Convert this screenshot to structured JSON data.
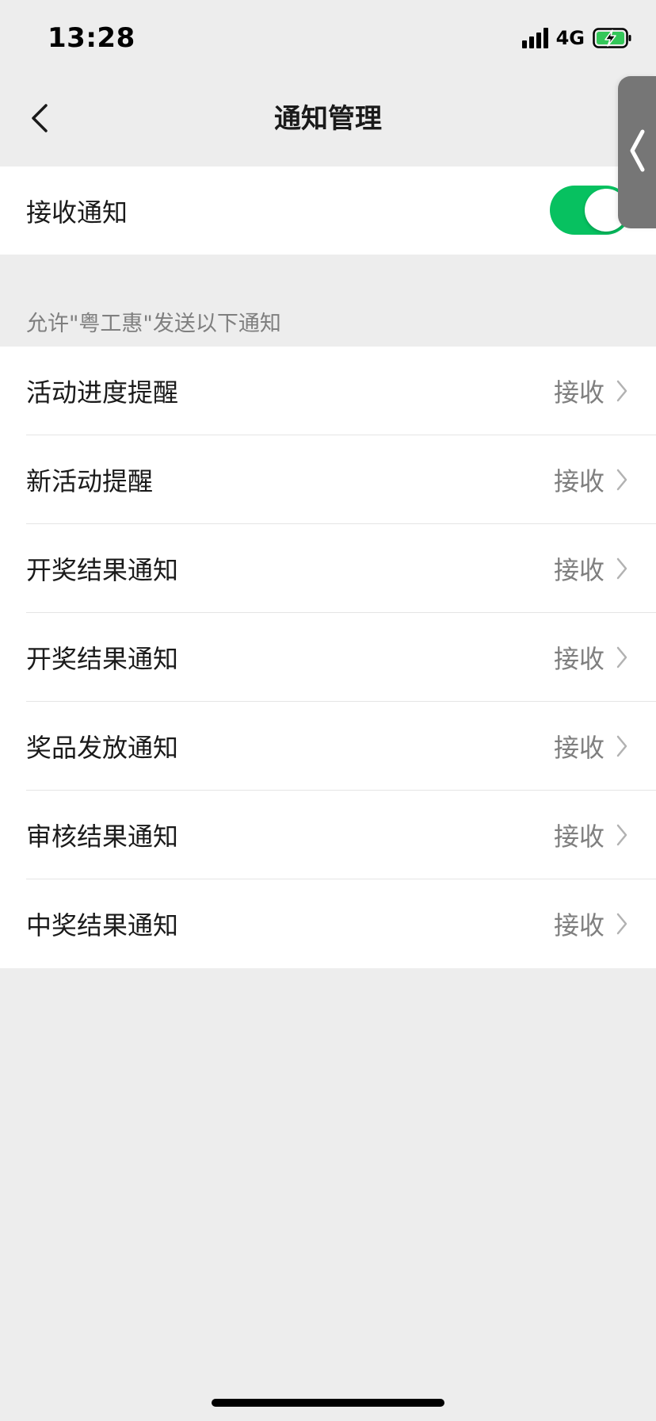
{
  "status_bar": {
    "time": "13:28",
    "network": "4G",
    "icons": [
      "signal-icon",
      "battery-charging-icon"
    ]
  },
  "nav": {
    "title": "通知管理",
    "back_icon": "chevron-left-icon",
    "side_handle_icon": "chevron-left-icon"
  },
  "receive": {
    "label": "接收通知",
    "enabled": true
  },
  "section": {
    "header": "允许\"粤工惠\"发送以下通知"
  },
  "items": [
    {
      "label": "活动进度提醒",
      "status": "接收"
    },
    {
      "label": "新活动提醒",
      "status": "接收"
    },
    {
      "label": "开奖结果通知",
      "status": "接收"
    },
    {
      "label": "开奖结果通知",
      "status": "接收"
    },
    {
      "label": "奖品发放通知",
      "status": "接收"
    },
    {
      "label": "审核结果通知",
      "status": "接收"
    },
    {
      "label": "中奖结果通知",
      "status": "接收"
    }
  ],
  "colors": {
    "accent": "#07c160",
    "background": "#ededed",
    "secondary_text": "#7f7f7f"
  }
}
